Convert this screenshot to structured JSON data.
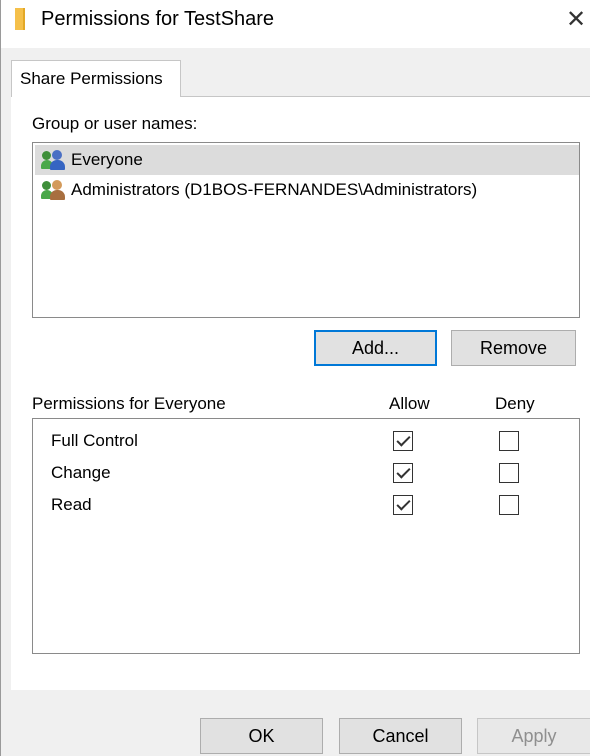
{
  "window": {
    "title": "Permissions for TestShare",
    "close_glyph": "✕"
  },
  "tabs": [
    {
      "label": "Share Permissions",
      "active": true
    }
  ],
  "users": {
    "label": "Group or user names:",
    "items": [
      {
        "name": "Everyone",
        "icon": "users-icon",
        "selected": true
      },
      {
        "name": "Administrators (D1BOS-FERNANDES\\Administrators)",
        "icon": "users-icon",
        "selected": false
      }
    ],
    "add_label": "Add...",
    "remove_label": "Remove"
  },
  "permissions": {
    "label": "Permissions for Everyone",
    "allow_label": "Allow",
    "deny_label": "Deny",
    "rows": [
      {
        "name": "Full Control",
        "allow": true,
        "deny": false
      },
      {
        "name": "Change",
        "allow": true,
        "deny": false
      },
      {
        "name": "Read",
        "allow": true,
        "deny": false
      }
    ]
  },
  "footer": {
    "ok_label": "OK",
    "cancel_label": "Cancel",
    "apply_label": "Apply"
  },
  "colors": {
    "focus_accent": "#0078d7",
    "selection": "#dcdcdc",
    "dialog_background": "#f0f0f0"
  }
}
